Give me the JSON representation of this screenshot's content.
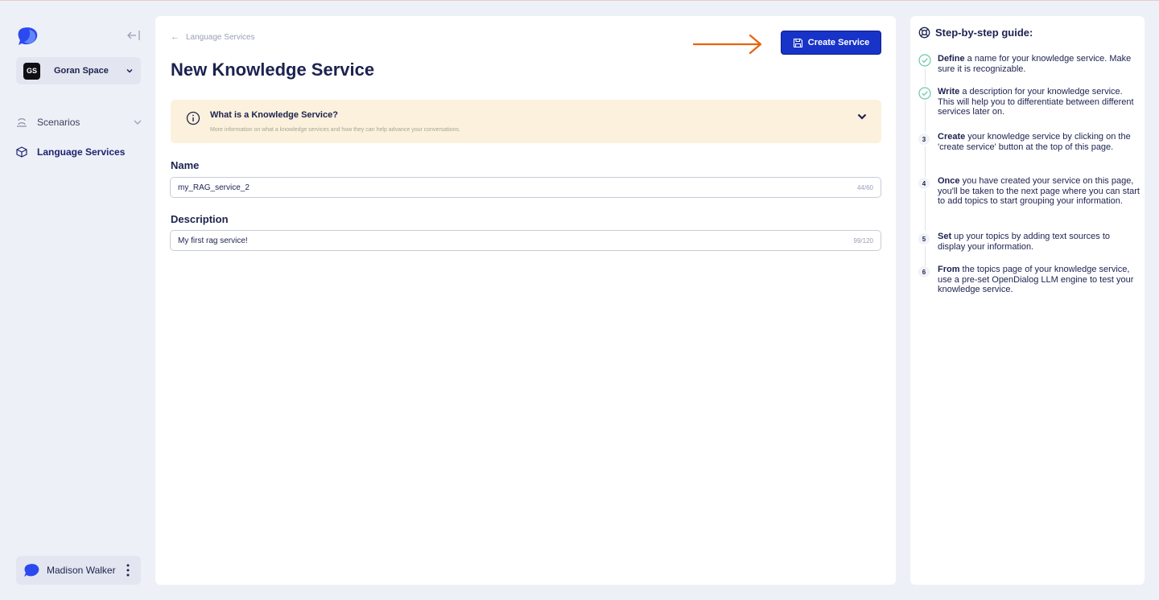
{
  "sidebar": {
    "workspace_badge": "GS",
    "workspace_name": "Goran Space",
    "nav": [
      {
        "label": "Scenarios",
        "icon": "scenarios-icon"
      },
      {
        "label": "Language Services",
        "icon": "cube-icon"
      }
    ],
    "user_name": "Madison Walker"
  },
  "main": {
    "breadcrumb": "Language Services",
    "title": "New Knowledge Service",
    "create_button": "Create Service",
    "banner": {
      "title": "What is a Knowledge Service?",
      "subtitle": "More information on what a knowledge services and how they can help advance your conversations."
    },
    "name_field": {
      "label": "Name",
      "value": "my_RAG_service_2",
      "count": "44/60"
    },
    "description_field": {
      "label": "Description",
      "value": "My first rag service!",
      "count": "99/120"
    }
  },
  "guide": {
    "title": "Step-by-step guide:",
    "steps": [
      {
        "marker": "check",
        "bold": "Define",
        "text": " a name for your knowledge service. Make sure it is recognizable."
      },
      {
        "marker": "check",
        "bold": "Write",
        "text": " a description for your knowledge service. This will help you to differentiate between different services later on."
      },
      {
        "marker": "3",
        "bold": "Create",
        "text": " your knowledge service by clicking on the 'create service' button at the top of this page."
      },
      {
        "marker": "4",
        "bold": "Once",
        "text": " you have created your service on this page, you'll be taken to the next page where you can start to add topics to start grouping your information."
      },
      {
        "marker": "5",
        "bold": "Set",
        "text": " up your topics by adding text sources to display your information."
      },
      {
        "marker": "6",
        "bold": "From",
        "text": " the topics page of your knowledge service, use a pre-set OpenDialog LLM engine to test your knowledge service."
      }
    ]
  },
  "colors": {
    "primary": "#1733c8",
    "accent_arrow": "#e8630a",
    "banner_bg": "#fbf1dc",
    "check": "#6cc9a8",
    "page_bg": "#eef0f7"
  }
}
